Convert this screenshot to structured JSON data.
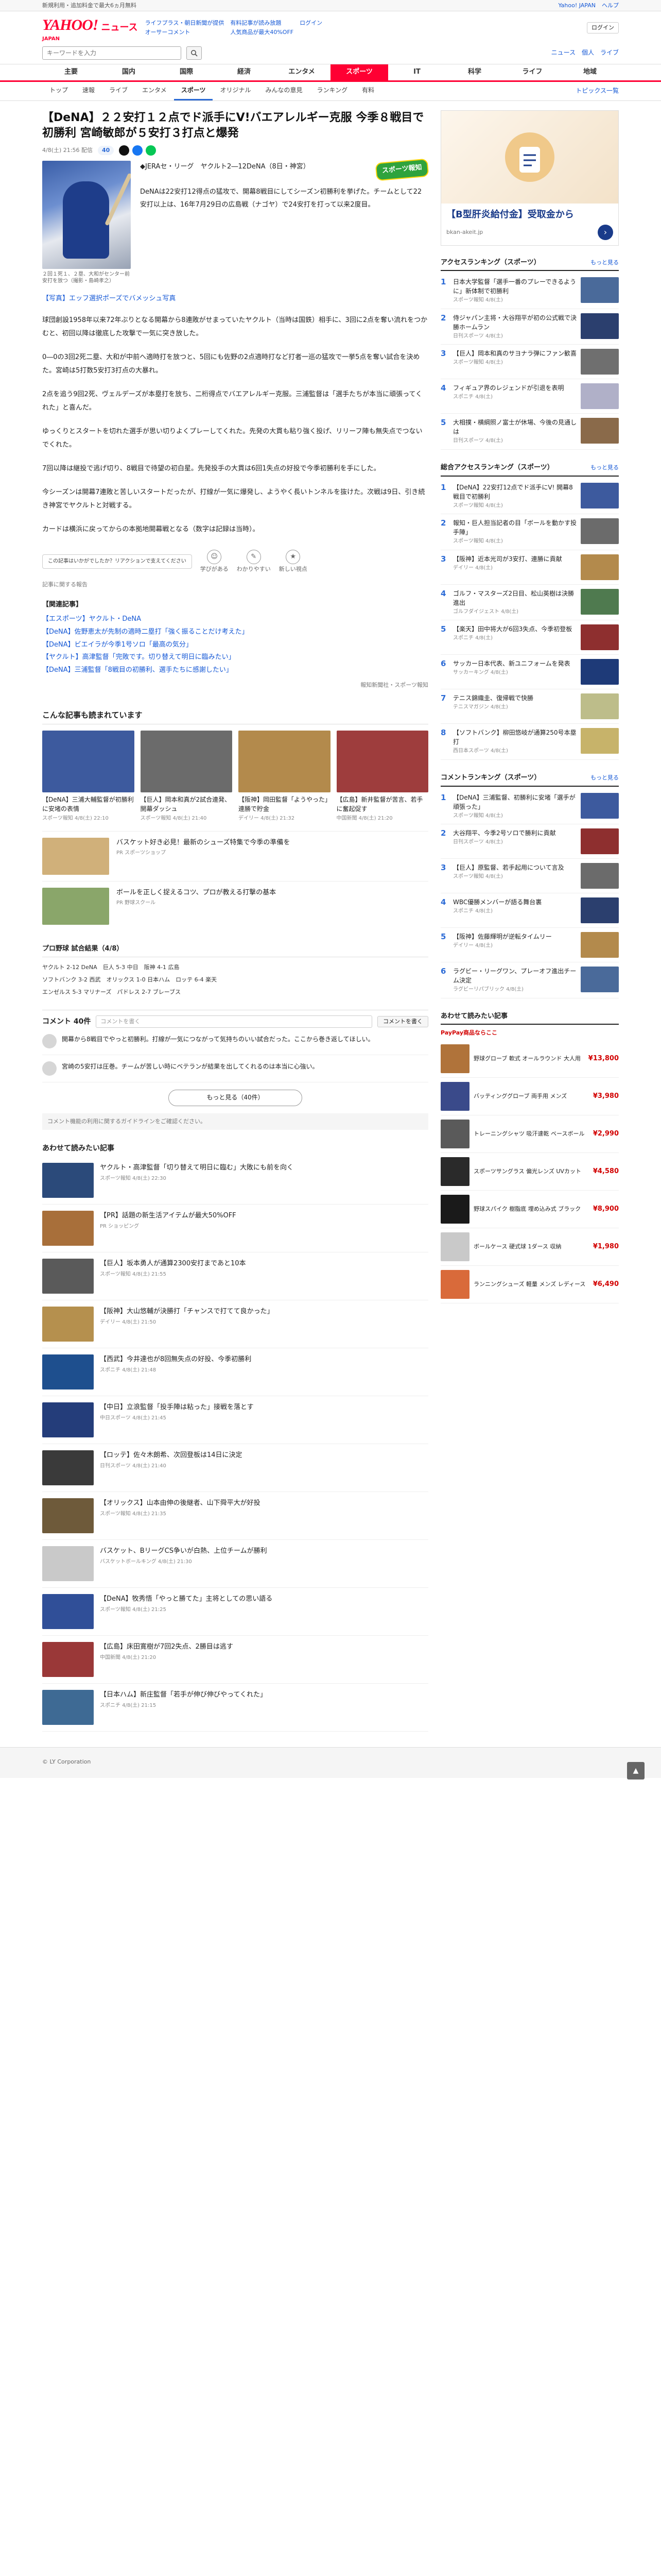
{
  "topbar": {
    "left": "新規利用・追加料金で最大6ヵ月無料",
    "links": [
      "Yahoo! JAPAN",
      "ヘルプ"
    ]
  },
  "masthead": {
    "logo_text": "YAHOO!",
    "logo_sub": "JAPAN",
    "service": "ニュース",
    "links": [
      "ライフプラス・朝日新聞が提供",
      "有料記事が読み放題",
      "ログイン",
      "オーサーコメント",
      "人気商品が最大40%OFF"
    ]
  },
  "search": {
    "placeholder": "キーワードを入力",
    "right_links": [
      "ニュース",
      "個人",
      "ライブ"
    ],
    "button": "検索"
  },
  "nav_tabs": [
    "主要",
    "国内",
    "国際",
    "経済",
    "エンタメ",
    "スポーツ",
    "IT",
    "科学",
    "ライフ",
    "地域"
  ],
  "nav_active": 5,
  "sub_tabs": [
    "トップ",
    "速報",
    "ライブ",
    "エンタメ",
    "スポーツ",
    "オリジナル",
    "みんなの意見",
    "ランキング",
    "有料"
  ],
  "sub_active": 4,
  "topics_link": "トピックス一覧",
  "article": {
    "title": "【DeNA】２２安打１２点でド派手にV!バエアレルギー克服 今季８戦目で初勝利 宮崎敏郎が５安打３打点と爆発",
    "date": "4/8(土) 21:56 配信",
    "comment_pill": "40",
    "badge": "スポーツ報知",
    "photo_caption": "２回１死１、２塁、大和がセンター前安打を放つ（撮影・島崎孝之）",
    "lead": "◆JERAセ・リーグ　ヤクルト2―12DeNA（8日・神宮）\n\nDeNAは22安打12得点の猛攻で、開幕8戦目にしてシーズン初勝利を挙げた。チームとして22安打以上は、16年7月29日の広島戦（ナゴヤ）で24安打を打って以来2度目。",
    "photo_link": "【写真】エッフ選択ポーズでバメッシュ写真",
    "paragraphs": [
      "球団創設1958年以来72年ぶりとなる開幕から8連敗がせまっていたヤクルト（当時は国鉄）相手に、3回に2点を奪い流れをつかむと、初回以降は徹底した攻撃で一気に突き放した。",
      "0―0の3回2死二塁、大和が中前へ適時打を放つと、5回にも佐野の2点適時打など打者一巡の猛攻で一挙5点を奪い試合を決めた。宮崎は5打数5安打3打点の大暴れ。",
      "2点を追う9回2死、ヴェルデーズが本塁打を放ち、二桁得点でバエアレルギー克服。三浦監督は「選手たちが本当に頑張ってくれた」と喜んだ。",
      "ゆっくりとスタートを切れた選手が思い切りよくプレーしてくれた。先発の大貫も粘り強く投げ、リリーフ陣も無失点でつないでくれた。",
      "7回以降は継投で逃げ切り、8戦目で待望の初白星。先発投手の大貫は6回1失点の好投で今季初勝利を手にした。",
      "今シーズンは開幕7連敗と苦しいスタートだったが、打線が一気に爆発し、ようやく長いトンネルを抜けた。次戦は9日、引き続き神宮でヤクルトと対戦する。",
      "カードは横浜に戻ってからの本拠地開幕戦となる（数字は記録は当時）。"
    ],
    "reaction_box": "この記事はいかがでしたか？リアクションで支えてください",
    "reactions": [
      {
        "icon": "☺",
        "label": "学びがある"
      },
      {
        "icon": "✎",
        "label": "わかりやすい"
      },
      {
        "icon": "★",
        "label": "新しい視点"
      }
    ],
    "report_link": "記事に関する報告",
    "related_head": "【関連記事】",
    "related": [
      "【エスポーツ】ヤクルト・DeNA",
      "【DeNA】佐野恵太が先制の適時二塁打「強く振ることだけ考えた」",
      "【DeNA】ビエイラが今季1号ソロ「最高の気分」",
      "【ヤクルト】高津監督「完敗です。切り替えて明日に臨みたい」",
      "【DeNA】三浦監督「8戦目の初勝利、選手たちに感謝したい」"
    ],
    "source": "報知新聞社",
    "source_tail": "スポーツ報知"
  },
  "recommend": {
    "title": "こんな記事も読まれています",
    "cards": [
      {
        "t": "【DeNA】三浦大輔監督が初勝利に安堵の表情",
        "s": "スポーツ報知 4/8(土) 22:10",
        "c": "#3d5a9e"
      },
      {
        "t": "【巨人】岡本和真が2試合連発、開幕ダッシュ",
        "s": "スポーツ報知 4/8(土) 21:40",
        "c": "#6b6b6b"
      },
      {
        "t": "【阪神】岡田監督「ようやった」連勝で貯金",
        "s": "デイリー 4/8(土) 21:32",
        "c": "#b38a4c"
      },
      {
        "t": "【広島】新井監督が苦言、若手に奮起促す",
        "s": "中国新聞 4/8(土) 21:20",
        "c": "#9e3d3d"
      }
    ],
    "rows": [
      {
        "t": "バスケット好き必見！最新のシューズ特集で今季の準備を",
        "s": "PR スポーツショップ",
        "pr": true,
        "c": "#d0b07a"
      },
      {
        "t": "ボールを正しく捉えるコツ、プロが教える打撃の基本",
        "s": "PR 野球スクール",
        "pr": true,
        "c": "#8aa66a"
      }
    ]
  },
  "scores": {
    "head": "プロ野球 試合結果（4/8）",
    "lines": [
      "ヤクルト 2-12 DeNA　巨人 5-3 中日　阪神 4-1 広島",
      "ソフトバンク 3-2 西武　オリックス 1-0 日本ハム　ロッテ 6-4 楽天",
      "エンゼルス 5-3 マリナーズ　パドレス 2-7 ブレーブス"
    ]
  },
  "comments": {
    "count_label": "コメント 40件",
    "input_placeholder": "コメントを書く",
    "post_button": "コメントを書く",
    "items": [
      {
        "txt": "開幕から8戦目でやっと初勝利。打線が一気につながって気持ちのいい試合だった。ここから巻き返してほしい。"
      },
      {
        "txt": "宮崎の5安打は圧巻。チームが苦しい時にベテランが結果を出してくれるのは本当に心強い。"
      }
    ],
    "more_button": "もっと見る（40件）",
    "notice": "コメント機能の利用に関するガイドラインをご確認ください。"
  },
  "feed": {
    "title": "あわせて読みたい記事",
    "items": [
      {
        "t": "ヤクルト・高津監督「切り替えて明日に臨む」大敗にも前を向く",
        "s": "スポーツ報知 4/8(土) 22:30",
        "c": "#2b4a7a"
      },
      {
        "t": "【PR】話題の新生活アイテムが最大50%OFF",
        "s": "PR ショッピング",
        "c": "#a86f3a"
      },
      {
        "t": "【巨人】坂本勇人が通算2300安打まであと10本",
        "s": "スポーツ報知 4/8(土) 21:55",
        "c": "#5a5a5a"
      },
      {
        "t": "【阪神】大山悠輔が決勝打「チャンスで打てて良かった」",
        "s": "デイリー 4/8(土) 21:50",
        "c": "#b5904e"
      },
      {
        "t": "【西武】今井達也が8回無失点の好投、今季初勝利",
        "s": "スポニチ 4/8(土) 21:48",
        "c": "#1e4f8e"
      },
      {
        "t": "【中日】立浪監督「投手陣は粘った」接戦を落とす",
        "s": "中日スポーツ 4/8(土) 21:45",
        "c": "#243d7a"
      },
      {
        "t": "【ロッテ】佐々木朗希、次回登板は14日に決定",
        "s": "日刊スポーツ 4/8(土) 21:40",
        "c": "#3a3a3a"
      },
      {
        "t": "【オリックス】山本由伸の後継者、山下舜平大が好投",
        "s": "スポーツ報知 4/8(土) 21:35",
        "c": "#6e5a3a"
      },
      {
        "t": "バスケット、BリーグCS争いが白熱、上位チームが勝利",
        "s": "バスケットボールキング 4/8(土) 21:30",
        "c": "#c9c9c9"
      },
      {
        "t": "【DeNA】牧秀悟「やっと勝てた」主将としての思い語る",
        "s": "スポーツ報知 4/8(土) 21:25",
        "c": "#304f98"
      },
      {
        "t": "【広島】床田寛樹が7回2失点、2勝目は逃す",
        "s": "中国新聞 4/8(土) 21:20",
        "c": "#9a3838"
      },
      {
        "t": "【日本ハム】新庄監督「若手が伸び伸びやってくれた」",
        "s": "スポニチ 4/8(土) 21:15",
        "c": "#3e6a94"
      }
    ]
  },
  "sidebar": {
    "ad": {
      "title": "【B型肝炎給付金】受取金から",
      "sub": "bkan-akeit.jp",
      "arrow": "›"
    },
    "access_ranking": {
      "title": "アクセスランキング（スポーツ）",
      "more": "もっと見る",
      "items": [
        {
          "t": "日本大学監督「選手一番のプレーできるように」新体制で初勝利",
          "s": "スポーツ報知 4/8(土)",
          "c": "#4a6a9a"
        },
        {
          "t": "侍ジャパン主将・大谷翔平が初の公式戦で決勝ホームラン",
          "s": "日刊スポーツ 4/8(土)",
          "c": "#2b3f6e"
        },
        {
          "t": "【巨人】岡本和真のサヨナラ弾にファン歓喜",
          "s": "スポーツ報知 4/8(土)",
          "c": "#6f6f6f"
        },
        {
          "t": "フィギュア界のレジェンドが引退を表明",
          "s": "スポニチ 4/8(土)",
          "c": "#b0b0c8"
        },
        {
          "t": "大相撲・横綱照ノ富士が休場、今後の見通しは",
          "s": "日刊スポーツ 4/8(土)",
          "c": "#8a6a4a"
        }
      ]
    },
    "access_ranking2": {
      "title": "総合アクセスランキング（スポーツ）",
      "more": "もっと見る",
      "items": [
        {
          "t": "【DeNA】22安打12点でド派手にV! 開幕8戦目で初勝利",
          "s": "スポーツ報知 4/8(土)",
          "c": "#3d5a9e"
        },
        {
          "t": "報知・巨人担当記者の目「ボールを動かす投手陣」",
          "s": "スポーツ報知 4/8(土)",
          "c": "#6b6b6b"
        },
        {
          "t": "【阪神】近本光司が3安打、連勝に貢献",
          "s": "デイリー 4/8(土)",
          "c": "#b38a4c"
        },
        {
          "t": "ゴルフ・マスターズ2日目、松山英樹は決勝進出",
          "s": "ゴルフダイジェスト 4/8(土)",
          "c": "#4f7a4f"
        },
        {
          "t": "【楽天】田中将大が6回3失点、今季初登板",
          "s": "スポニチ 4/8(土)",
          "c": "#8e2f2f"
        },
        {
          "t": "サッカー日本代表、新ユニフォームを発表",
          "s": "サッカーキング 4/8(土)",
          "c": "#1e3a78"
        },
        {
          "t": "テニス錦織圭、復帰戦で快勝",
          "s": "テニスマガジン 4/8(土)",
          "c": "#bdbd8a"
        },
        {
          "t": "【ソフトバンク】柳田悠岐が通算250号本塁打",
          "s": "西日本スポーツ 4/8(土)",
          "c": "#c7b36a"
        }
      ]
    },
    "ranking3": {
      "title": "コメントランキング（スポーツ）",
      "more": "もっと見る",
      "items": [
        {
          "t": "【DeNA】三浦監督、初勝利に安堵「選手が頑張った」",
          "s": "スポーツ報知 4/8(土)",
          "c": "#3d5a9e"
        },
        {
          "t": "大谷翔平、今季2号ソロで勝利に貢献",
          "s": "日刊スポーツ 4/8(土)",
          "c": "#8e2f2f"
        },
        {
          "t": "【巨人】原監督、若手起用について言及",
          "s": "スポーツ報知 4/8(土)",
          "c": "#6b6b6b"
        },
        {
          "t": "WBC優勝メンバーが語る舞台裏",
          "s": "スポニチ 4/8(土)",
          "c": "#2b3f6e"
        },
        {
          "t": "【阪神】佐藤輝明が逆転タイムリー",
          "s": "デイリー 4/8(土)",
          "c": "#b38a4c"
        },
        {
          "t": "ラグビー・リーグワン、プレーオフ進出チーム決定",
          "s": "ラグビーリパブリック 4/8(土)",
          "c": "#4a6a9a"
        }
      ]
    },
    "shopping": {
      "title": "あわせて読みたい記事",
      "paypay": "PayPay商品ならここ",
      "items": [
        {
          "t": "野球グローブ 軟式 オールラウンド 大人用",
          "price": "¥13,800",
          "c": "#b0733a"
        },
        {
          "t": "バッティンググローブ 両手用 メンズ",
          "price": "¥3,980",
          "c": "#3a4a8a"
        },
        {
          "t": "トレーニングシャツ 吸汗速乾 ベースボール",
          "price": "¥2,990",
          "c": "#5a5a5a"
        },
        {
          "t": "スポーツサングラス 偏光レンズ UVカット",
          "price": "¥4,580",
          "c": "#2a2a2a"
        },
        {
          "t": "野球スパイク 樹脂底 埋め込み式 ブラック",
          "price": "¥8,900",
          "c": "#1a1a1a"
        },
        {
          "t": "ボールケース 硬式球 1ダース 収納",
          "price": "¥1,980",
          "c": "#c9c9c9"
        },
        {
          "t": "ランニングシューズ 軽量 メンズ レディース",
          "price": "¥6,490",
          "c": "#d96a3a"
        }
      ]
    }
  },
  "pagetop": "▲",
  "footer": "© LY Corporation"
}
